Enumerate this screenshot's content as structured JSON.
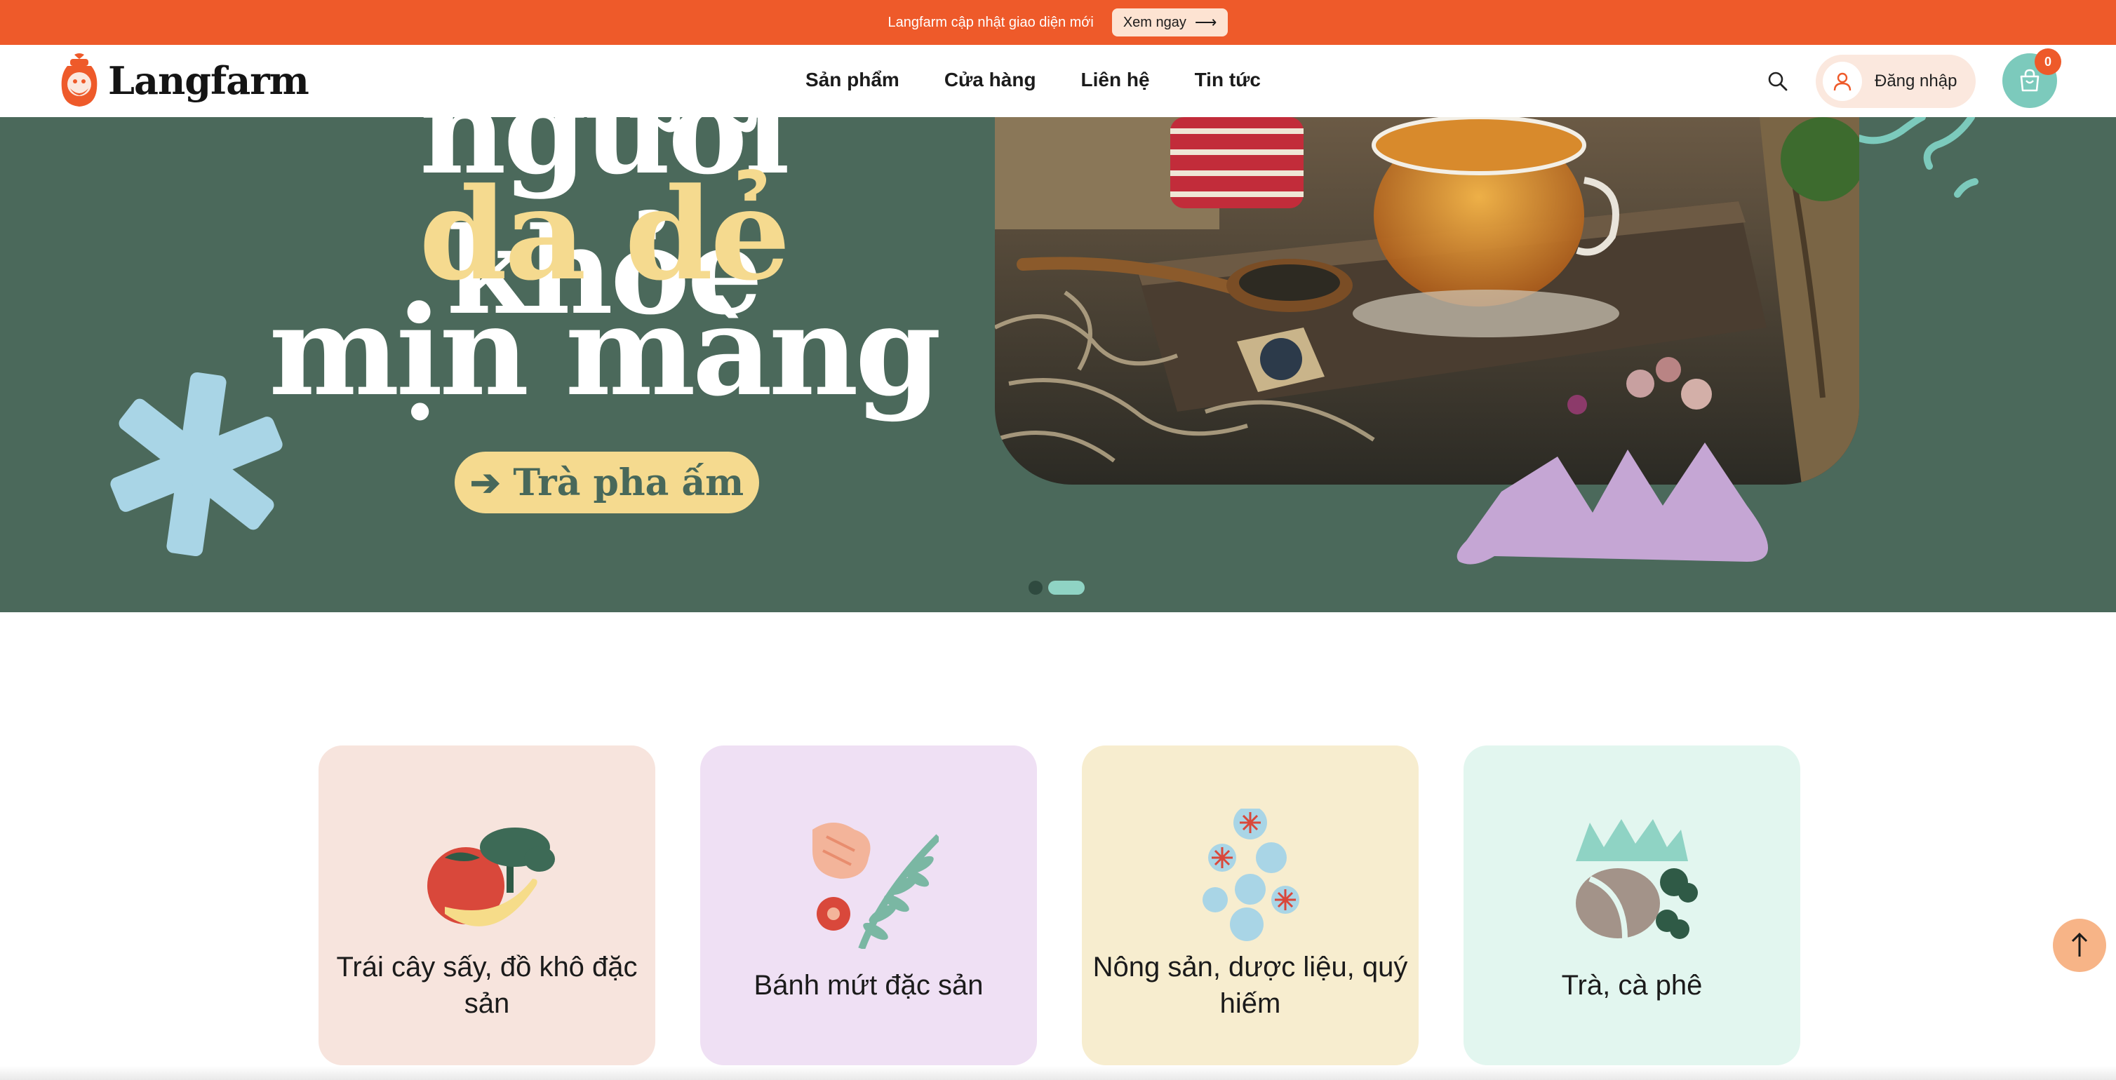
{
  "announcement": {
    "text": "Langfarm cập nhật giao diện mới",
    "button_label": "Xem ngay"
  },
  "header": {
    "logo_text": "Langfarm",
    "nav": [
      "Sản phẩm",
      "Cửa hàng",
      "Liên hệ",
      "Tin tức"
    ],
    "login_label": "Đăng nhập",
    "cart_count": "0"
  },
  "hero": {
    "line1": "người khỏe",
    "line2": "da dẻ",
    "line3": "mịn màng",
    "cta_label": "Trà pha ấm",
    "slides_total": 2,
    "active_slide": 2
  },
  "categories": [
    {
      "label": "Trái cây sấy, đồ khô đặc sản"
    },
    {
      "label": "Bánh mứt đặc sản"
    },
    {
      "label": "Nông sản, dược liệu, quý hiếm"
    },
    {
      "label": "Trà, cà phê"
    }
  ],
  "colors": {
    "brand_orange": "#ee5a2a",
    "hero_green": "#4b695b",
    "hero_yellow": "#f5da8f",
    "cart_teal": "#7ccabc"
  },
  "icons": [
    "arrow-right-icon",
    "search-icon",
    "user-icon",
    "shopping-bag-icon",
    "arrow-up-icon"
  ]
}
